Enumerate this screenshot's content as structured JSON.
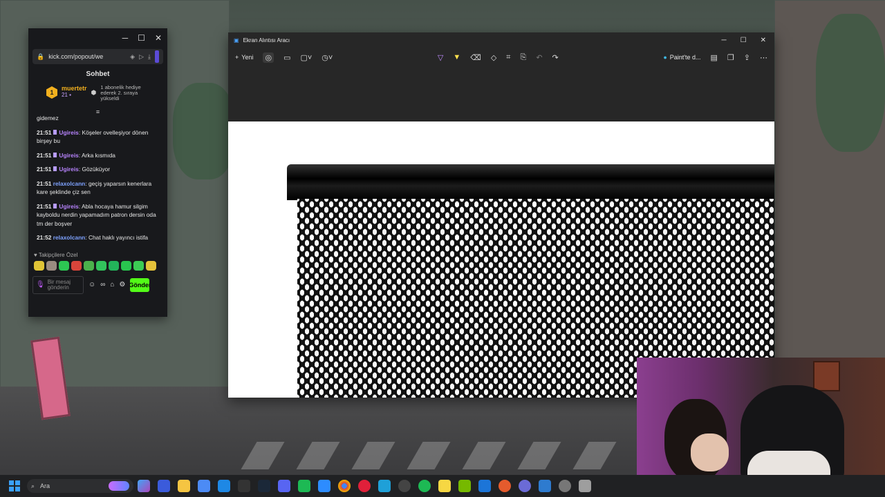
{
  "chat": {
    "url": "kick.com/popout/we",
    "header": "Sohbet",
    "pinned": {
      "rank": "1",
      "username": "muertetr",
      "count": "21",
      "message": "1 abonelik hediye ederek 2. sıraya yükseldi"
    },
    "partial_message": "gidemez",
    "messages": [
      {
        "time": "21:51",
        "user": "Ugireis",
        "color": "purple",
        "badge": true,
        "text": ": Köşeler ovelleşiyor dönen birşey bu"
      },
      {
        "time": "21:51",
        "user": "Ugireis",
        "color": "purple",
        "badge": true,
        "text": ": Arka kısmıda"
      },
      {
        "time": "21:51",
        "user": "Ugireis",
        "color": "purple",
        "badge": true,
        "text": ": Gözüküyor"
      },
      {
        "time": "21:51",
        "user": "relaxolcann",
        "color": "blue",
        "badge": false,
        "text": ": geçiş yaparsın kenerlara kare şeklinde çiz sen"
      },
      {
        "time": "21:51",
        "user": "Ugireis",
        "color": "purple",
        "badge": true,
        "text": ": Abla hocaya hamur silgim kayboldu nerdin yapamadım patron dersin oda tm der boşver"
      },
      {
        "time": "21:52",
        "user": "relaxolcann",
        "color": "blue",
        "badge": false,
        "text": ": Chat haklı yayıncı istifa"
      }
    ],
    "followers_label": "Takipçilere Özel",
    "input_placeholder": "Bir mesaj gönderin",
    "send_label": "Gönder"
  },
  "snip": {
    "title": "Ekran Alıntısı Aracı",
    "new_label": "Yeni",
    "paint_label": "Paint'te d..."
  },
  "taskbar": {
    "search_label": "Ara"
  },
  "colors": {
    "kick_green": "#53fc18",
    "snip_bg": "#272727",
    "taskbar_bg": "#202123"
  }
}
